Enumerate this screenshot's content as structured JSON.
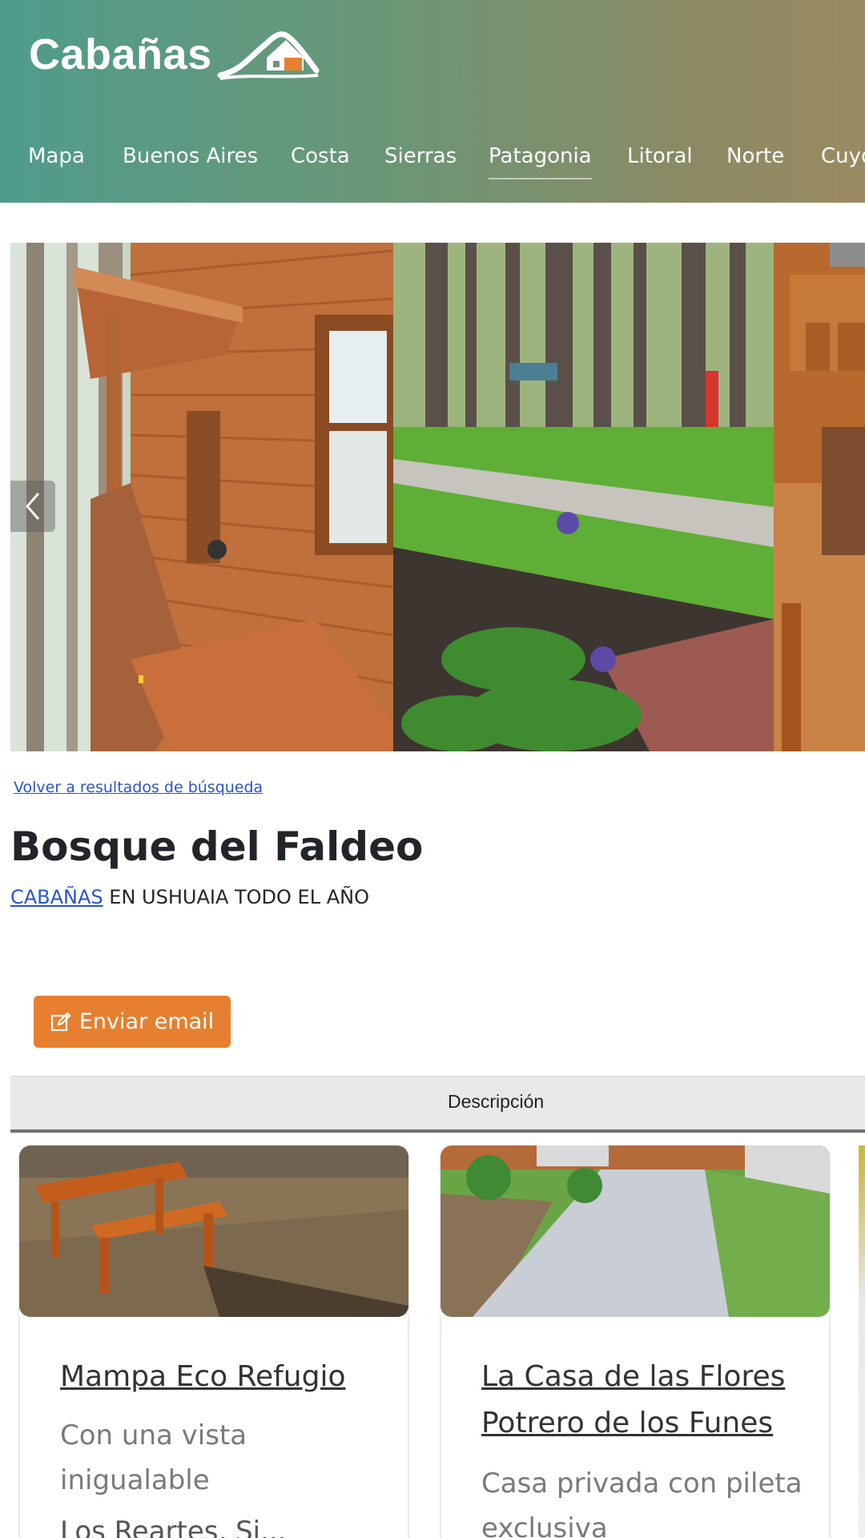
{
  "header": {
    "logo_text": "Cabañas",
    "nav": [
      {
        "label": "Mapa"
      },
      {
        "label": "Buenos Aires"
      },
      {
        "label": "Costa"
      },
      {
        "label": "Sierras"
      },
      {
        "label": "Patagonia",
        "active": true
      },
      {
        "label": "Litoral"
      },
      {
        "label": "Norte"
      },
      {
        "label": "Cuyo"
      }
    ]
  },
  "gallery": {
    "photos": [
      "cabin-porch-photo",
      "forest-garden-photo",
      "cabin-interior-photo"
    ]
  },
  "listing": {
    "back_link": "Volver a resultados de búsqueda",
    "title": "Bosque del Faldeo",
    "category_link": "CABAÑAS",
    "subtitle_rest": " EN USHUAIA TODO EL AÑO",
    "email_button": "Enviar email"
  },
  "tabs": {
    "active": "Descripción"
  },
  "cards": [
    {
      "title": "Mampa Eco Refugio",
      "description": "Con una vista inigualable",
      "extra": "Los Reartes, Si..."
    },
    {
      "title": "La Casa de las Flores Potrero de los Funes",
      "description": "Casa privada con pileta exclusiva"
    }
  ],
  "colors": {
    "accent": "#e67f2f",
    "link": "#2a55c7",
    "header_start": "#4f9c8c",
    "header_end": "#9a8a62"
  }
}
